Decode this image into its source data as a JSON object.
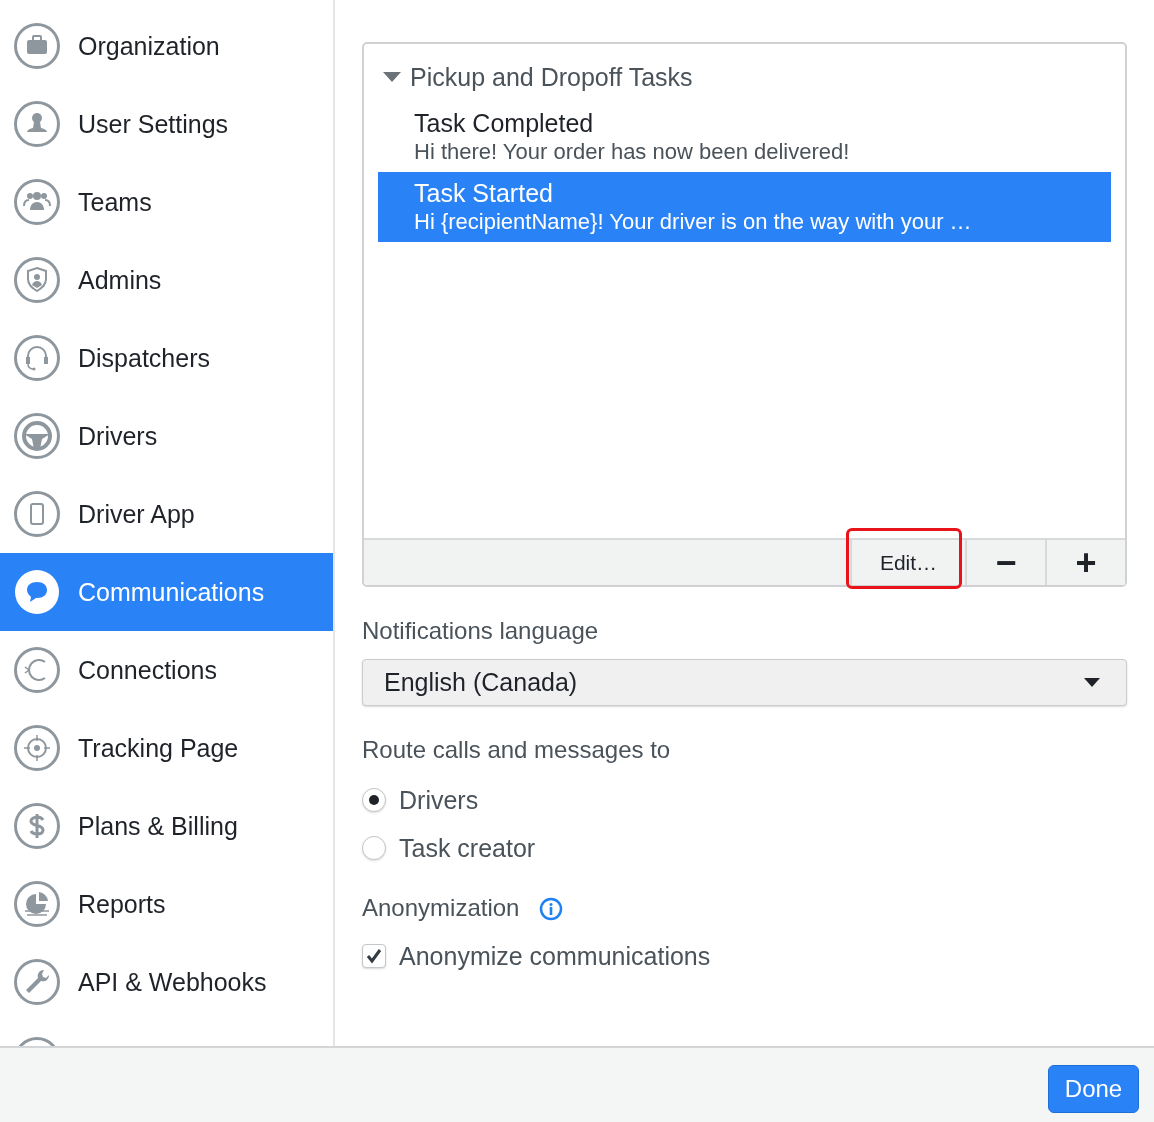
{
  "sidebar": {
    "items": [
      {
        "label": "Organization",
        "selected": false
      },
      {
        "label": "User Settings",
        "selected": false
      },
      {
        "label": "Teams",
        "selected": false
      },
      {
        "label": "Admins",
        "selected": false
      },
      {
        "label": "Dispatchers",
        "selected": false
      },
      {
        "label": "Drivers",
        "selected": false
      },
      {
        "label": "Driver App",
        "selected": false
      },
      {
        "label": "Communications",
        "selected": true
      },
      {
        "label": "Connections",
        "selected": false
      },
      {
        "label": "Tracking Page",
        "selected": false
      },
      {
        "label": "Plans & Billing",
        "selected": false
      },
      {
        "label": "Reports",
        "selected": false
      },
      {
        "label": "API & Webhooks",
        "selected": false
      }
    ]
  },
  "task_list": {
    "group": {
      "title": "Pickup and Dropoff Tasks",
      "expanded": true
    },
    "items": [
      {
        "title": "Task Completed",
        "message": "Hi there! Your order has now been delivered!",
        "selected": false
      },
      {
        "title": "Task Started",
        "message": "Hi {recipientName}! Your driver is on the way with your …",
        "selected": true
      }
    ],
    "toolbar": [
      {
        "kind": "text",
        "label": "Edit…",
        "highlighted": true
      },
      {
        "kind": "remove",
        "label": "−",
        "highlighted": false
      },
      {
        "kind": "add",
        "label": "+",
        "highlighted": false
      }
    ]
  },
  "notifications_language": {
    "label": "Notifications language",
    "value": "English (Canada)"
  },
  "route": {
    "label": "Route calls and messages to",
    "options": [
      {
        "label": "Drivers",
        "selected": true
      },
      {
        "label": "Task creator",
        "selected": false
      }
    ]
  },
  "anonymization": {
    "label": "Anonymization",
    "checkbox": {
      "label": "Anonymize communications",
      "checked": true
    }
  },
  "footer": {
    "done_button": "Done"
  }
}
